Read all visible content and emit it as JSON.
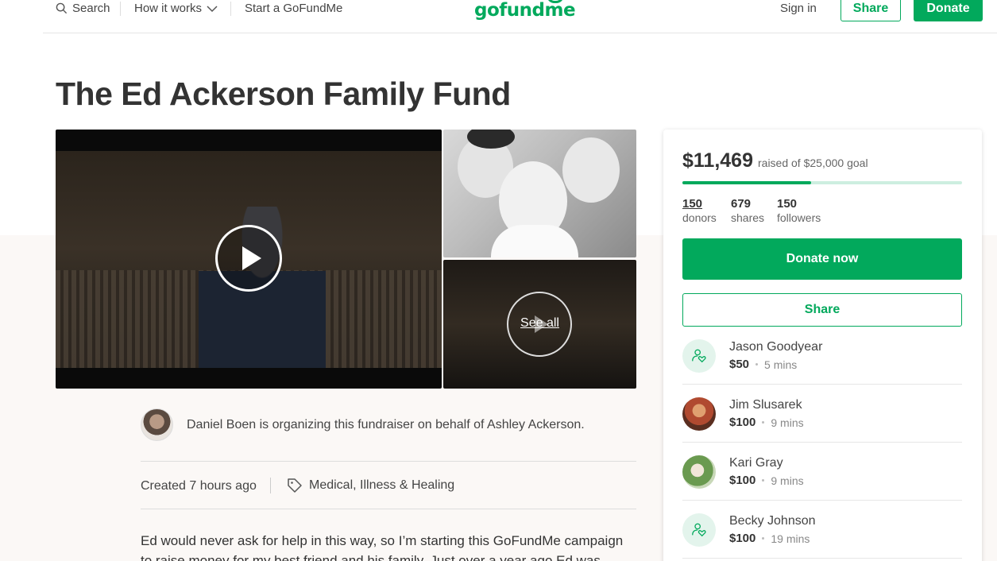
{
  "header": {
    "search_label": "Search",
    "how_it_works_label": "How it works",
    "start_label": "Start a GoFundMe",
    "logo_text": "gofundme",
    "signin_label": "Sign in",
    "share_label": "Share",
    "donate_label": "Donate"
  },
  "campaign": {
    "title": "The Ed Ackerson Family Fund",
    "see_all_label": "See all",
    "organizer_text": "Daniel Boen is organizing this fundraiser on behalf of Ashley Ackerson.",
    "created_text": "Created 7 hours ago",
    "category": "Medical, Illness & Healing",
    "story_text": "Ed would never ask for help in this way, so I’m starting this GoFundMe campaign to raise money for my best friend and his family. Just over a year ago Ed was"
  },
  "sidebar": {
    "amount_raised": "$11,469",
    "goal_text": "raised of $25,000 goal",
    "progress_fraction": 0.459,
    "stats": [
      {
        "num": "150",
        "label": "donors"
      },
      {
        "num": "679",
        "label": "shares"
      },
      {
        "num": "150",
        "label": "followers"
      }
    ],
    "donate_now_label": "Donate now",
    "share_label": "Share",
    "donors": [
      {
        "name": "Jason Goodyear",
        "amount": "$50",
        "time": "5 mins",
        "avatar": "donor-heart-icon"
      },
      {
        "name": "Jim Slusarek",
        "amount": "$100",
        "time": "9 mins",
        "avatar": "photo"
      },
      {
        "name": "Kari Gray",
        "amount": "$100",
        "time": "9 mins",
        "avatar": "photo"
      },
      {
        "name": "Becky Johnson",
        "amount": "$100",
        "time": "19 mins",
        "avatar": "donor-heart-icon"
      }
    ]
  },
  "colors": {
    "brand_green": "#02a95c",
    "progress_track": "#cdeee0",
    "lower_background": "#fbf8f6"
  }
}
